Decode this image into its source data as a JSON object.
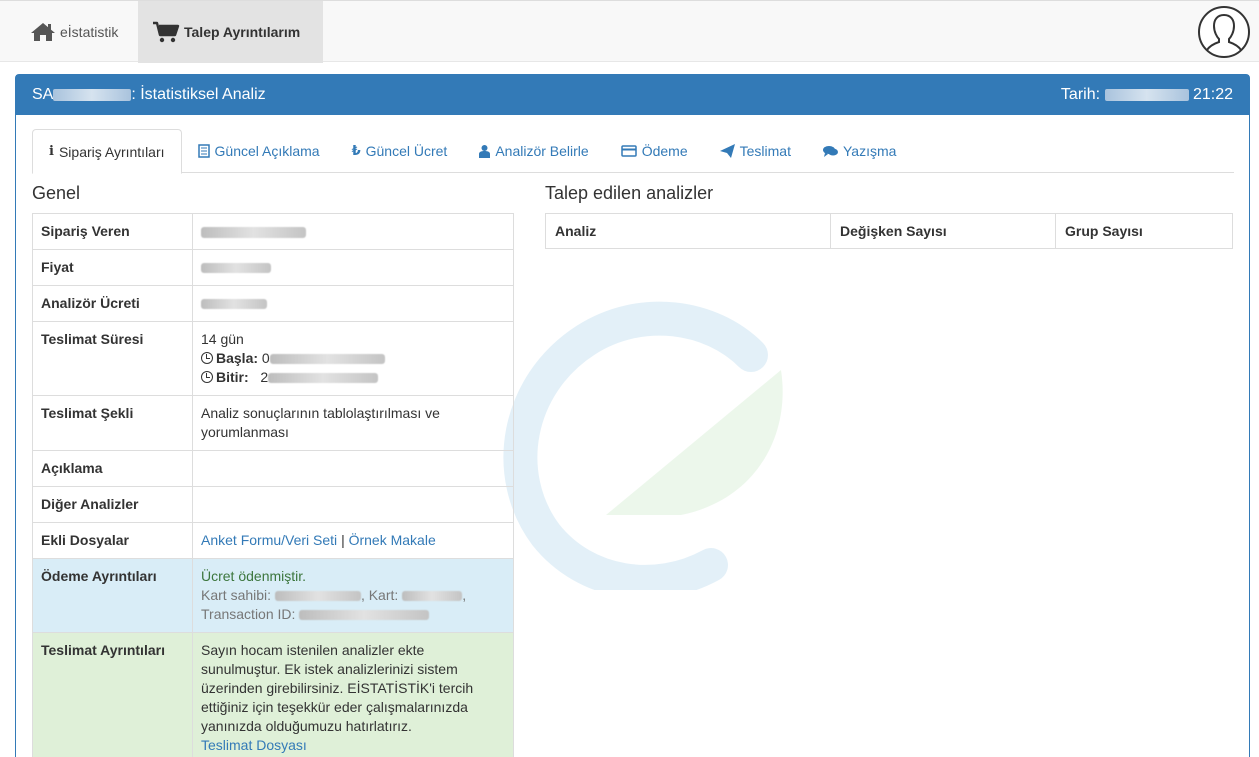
{
  "nav": {
    "home_label": "eİstatistik",
    "active_label": "Talep Ayrıntılarım"
  },
  "panel": {
    "title_prefix": "SA",
    "title_suffix": ": İstatistiksel Analiz",
    "date_label": "Tarih:",
    "date_time": "21:22"
  },
  "tabs": [
    {
      "label": "Sipariş Ayrıntıları",
      "icon": "info-icon",
      "active": true
    },
    {
      "label": "Güncel Açıklama",
      "icon": "document-icon",
      "active": false
    },
    {
      "label": "Güncel Ücret",
      "icon": "lira-icon",
      "active": false
    },
    {
      "label": "Analizör Belirle",
      "icon": "user-icon",
      "active": false
    },
    {
      "label": "Ödeme",
      "icon": "credit-card-icon",
      "active": false
    },
    {
      "label": "Teslimat",
      "icon": "send-icon",
      "active": false
    },
    {
      "label": "Yazışma",
      "icon": "comments-icon",
      "active": false
    }
  ],
  "genel": {
    "title": "Genel",
    "rows": {
      "siparis_veren": "Sipariş Veren",
      "fiyat": "Fiyat",
      "analizor_ucreti": "Analizör Ücreti",
      "teslimat_suresi": "Teslimat Süresi",
      "teslimat_suresi_value": "14 gün",
      "basla": "Başla:",
      "basla_prefix": "0",
      "bitir": "Bitir:",
      "bitir_prefix": "2",
      "teslimat_sekli": "Teslimat Şekli",
      "teslimat_sekli_value": "Analiz sonuçlarının tablolaştırılması ve yorumlanması",
      "aciklama": "Açıklama",
      "diger_analizler": "Diğer Analizler",
      "ekli_dosyalar": "Ekli Dosyalar",
      "anket_link": "Anket Formu/Veri Seti",
      "separator": "|",
      "ornek_link": "Örnek Makale",
      "odeme": "Ödeme Ayrıntıları",
      "odeme_status": "Ücret ödenmiştir.",
      "kart_sahibi": "Kart sahibi:",
      "kart": ", Kart:",
      "comma": ",",
      "transaction": "Transaction ID:",
      "teslimat_ayrintilari": "Teslimat Ayrıntıları",
      "teslimat_mesaji": "Sayın hocam istenilen analizler ekte sunulmuştur. Ek istek analizlerinizi sistem üzerinden girebilirsiniz. EİSTATİSTİK'i tercih ettiğiniz için teşekkür eder çalışmalarınızda yanınızda olduğumuzu hatırlatırız.",
      "teslimat_dosyasi": "Teslimat Dosyası"
    }
  },
  "talep": {
    "title": "Talep edilen analizler",
    "columns": [
      "Analiz",
      "Değişken Sayısı",
      "Grup Sayısı"
    ]
  },
  "colors": {
    "primary": "#337ab7",
    "info_row": "#d9edf7",
    "success_row": "#dff0d8",
    "success_text": "#3c763d"
  }
}
